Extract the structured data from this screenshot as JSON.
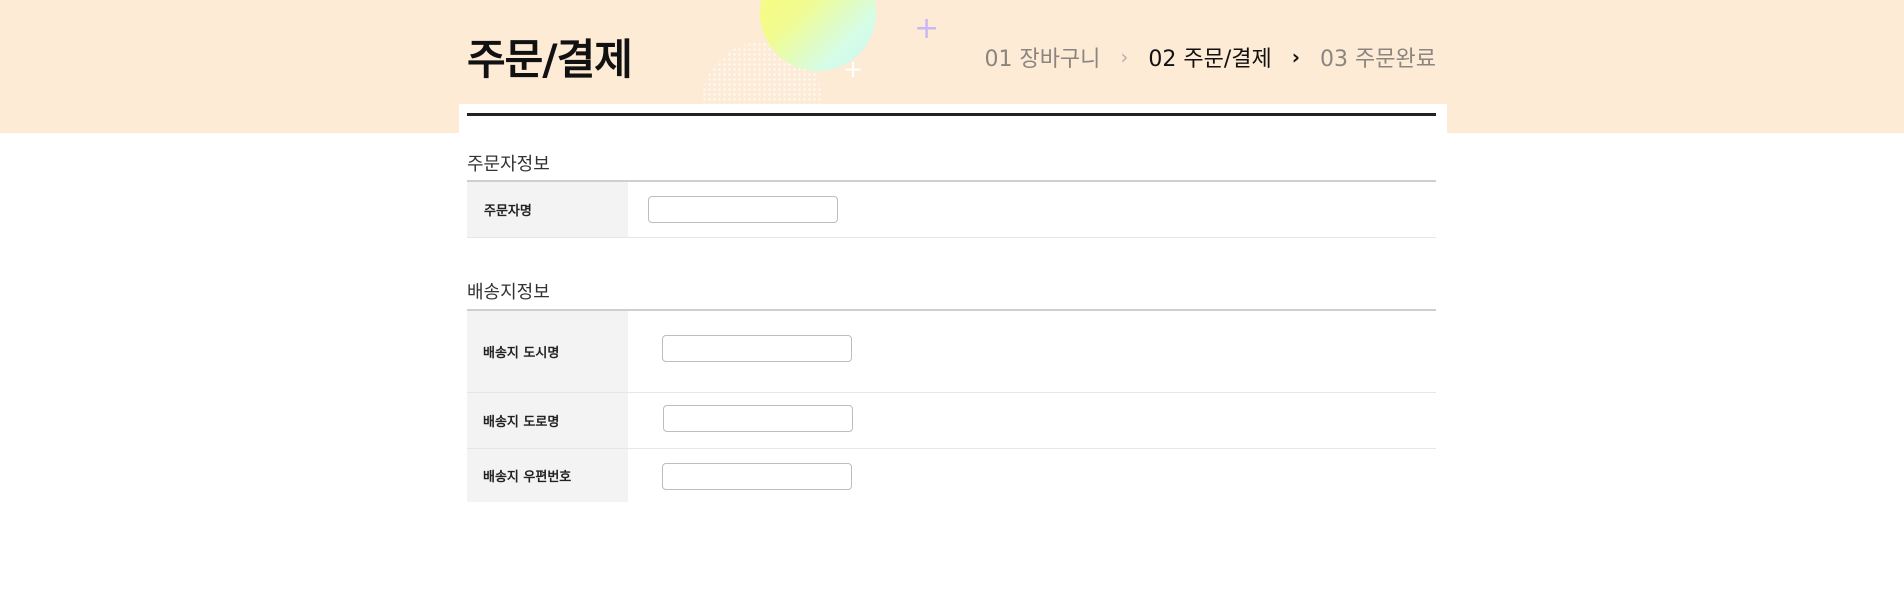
{
  "header": {
    "title": "주문/결제",
    "steps": [
      {
        "label": "01 장바구니"
      },
      {
        "label": "02 주문/결제"
      },
      {
        "label": "03 주문완료"
      }
    ],
    "step_separator": "›",
    "active_step": 2,
    "decor": {
      "plus_icon": "+",
      "circle_colors": [
        "#fbfb7a",
        "#c8f6f2"
      ],
      "background_color": "#fdebd6"
    }
  },
  "orderer_section": {
    "title": "주문자정보",
    "fields": [
      {
        "label": "주문자명",
        "value": "",
        "placeholder": ""
      }
    ]
  },
  "shipping_section": {
    "title": "배송지정보",
    "fields": [
      {
        "label": "배송지 도시명",
        "value": "",
        "placeholder": ""
      },
      {
        "label": "배송지  도로명",
        "value": "",
        "placeholder": ""
      },
      {
        "label": "배송지 우편번호",
        "value": "",
        "placeholder": ""
      }
    ]
  }
}
